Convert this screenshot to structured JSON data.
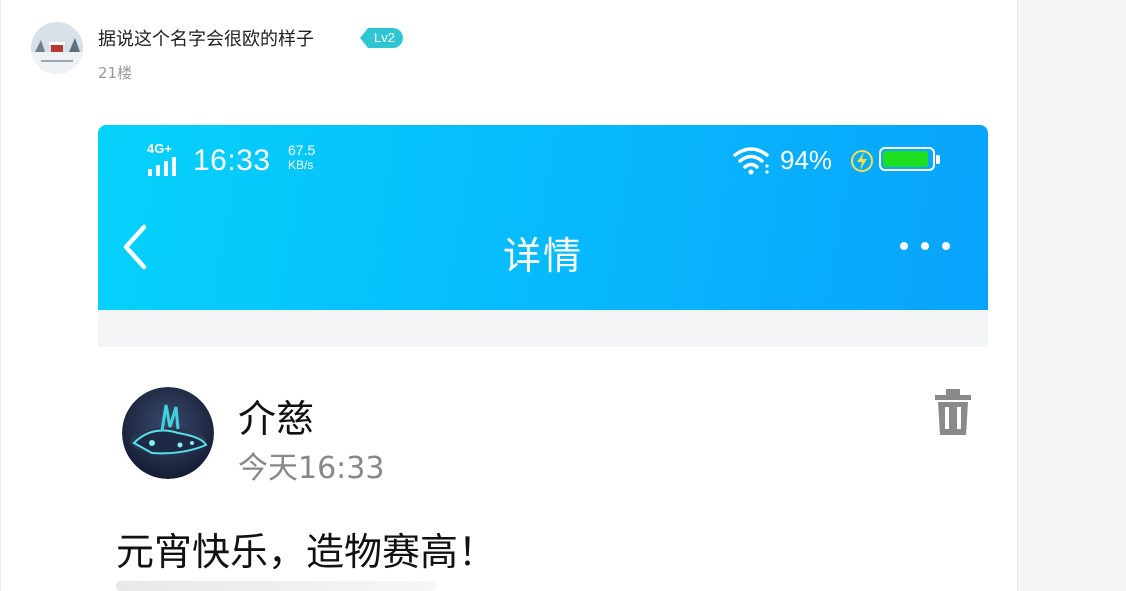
{
  "post": {
    "username": "据说这个名字会很欧的样子",
    "level_badge": "Lv2",
    "floor": "21楼",
    "avatar_icon": "snow-scene-avatar",
    "badge_color": "#2fc6d4"
  },
  "screenshot": {
    "status_bar": {
      "network": "4G+",
      "time": "16:33",
      "speed_value": "67.5",
      "speed_unit": "KB/s",
      "battery_percent": "94%",
      "battery_level": 0.94,
      "battery_color": "#1fe01f"
    },
    "app_bar": {
      "title": "详情",
      "back_icon": "chevron-left-icon",
      "more_icon": "more-dots-icon",
      "gradient_start": "#05d2fb",
      "gradient_end": "#09a3fc"
    },
    "item": {
      "author": "介慈",
      "time": "今天16:33",
      "delete_icon": "trash-icon",
      "text": "元宵快乐，造物赛高！"
    }
  }
}
